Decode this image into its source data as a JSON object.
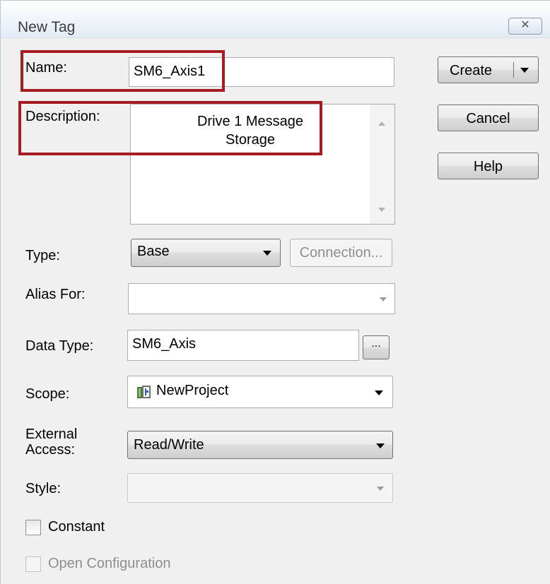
{
  "dialog": {
    "title": "New Tag",
    "close_glyph": "✕"
  },
  "buttons": {
    "create": "Create",
    "cancel": "Cancel",
    "help": "Help",
    "connection": "Connection...",
    "browse": "..."
  },
  "fields": {
    "name": {
      "label": "Name:",
      "value": "SM6_Axis1"
    },
    "description": {
      "label": "Description:",
      "value_line1": "Drive 1 Message",
      "value_line2": "Storage"
    },
    "type": {
      "label": "Type:",
      "value": "Base"
    },
    "alias_for": {
      "label": "Alias For:",
      "value": ""
    },
    "data_type": {
      "label": "Data Type:",
      "value": "SM6_Axis"
    },
    "scope": {
      "label": "Scope:",
      "value": "NewProject"
    },
    "external_access": {
      "label_line1": "External",
      "label_line2": "Access:",
      "value": "Read/Write"
    },
    "style": {
      "label": "Style:",
      "value": ""
    }
  },
  "checkboxes": {
    "constant": {
      "label": "Constant",
      "checked": false,
      "enabled": true
    },
    "open_configuration": {
      "label": "Open Configuration",
      "checked": false,
      "enabled": false
    }
  },
  "colors": {
    "highlight_border": "#a51c22",
    "dialog_bg": "#f0f0f0"
  },
  "icons": [
    "close-icon",
    "chevron-down-icon",
    "scroll-up-icon",
    "scroll-down-icon",
    "project-icon"
  ]
}
